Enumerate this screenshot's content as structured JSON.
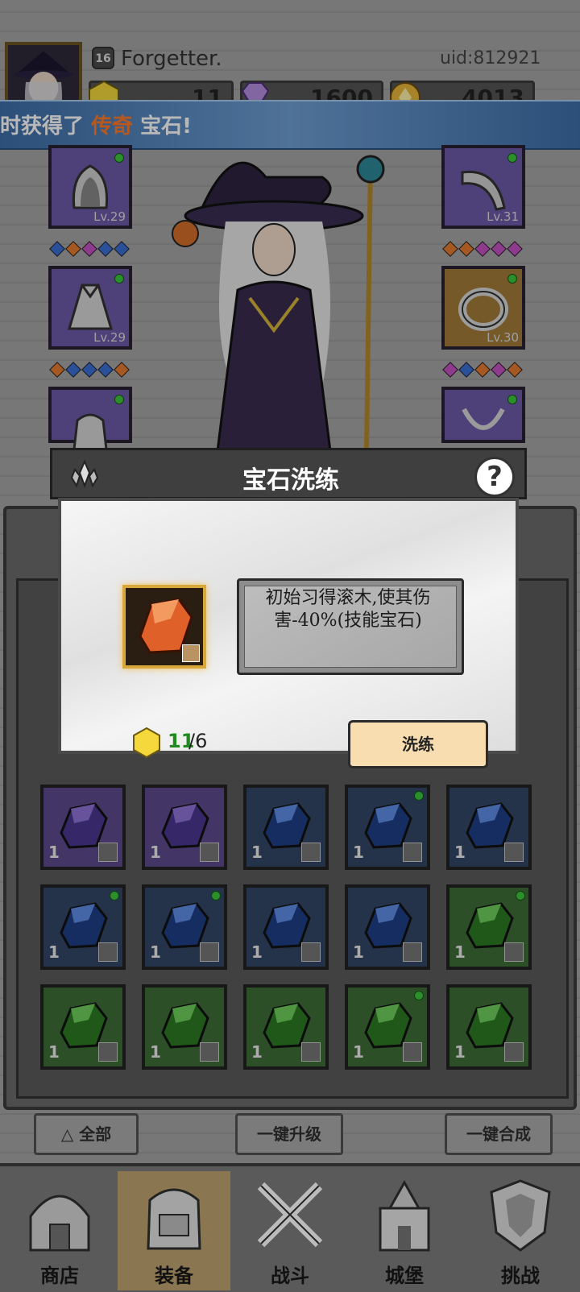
{
  "player": {
    "name": "Forgetter.",
    "level": "16",
    "uid": "uid:812921"
  },
  "currencies": [
    {
      "icon": "hex-gem-icon",
      "value": "11"
    },
    {
      "icon": "diamond-icon",
      "value": "1600"
    },
    {
      "icon": "coin-icon",
      "value": "4013"
    }
  ],
  "banner": {
    "prefix": "时获得了",
    "highlight": "传奇",
    "suffix": "宝石!"
  },
  "equipment": {
    "left": [
      {
        "item": "hood",
        "level": "Lv.29"
      },
      {
        "item": "cloak",
        "level": "Lv.29"
      },
      {
        "item": "bag",
        "level": ""
      }
    ],
    "right": [
      {
        "item": "horn",
        "level": "Lv.31"
      },
      {
        "item": "ring",
        "level": "Lv.30"
      },
      {
        "item": "necklace",
        "level": ""
      }
    ]
  },
  "inventory": {
    "rows": [
      [
        {
          "color": "purple",
          "count": "1",
          "dot": false
        },
        {
          "color": "purple",
          "count": "1",
          "dot": false
        },
        {
          "color": "blue",
          "count": "1",
          "dot": false
        },
        {
          "color": "blue",
          "count": "1",
          "dot": true
        },
        {
          "color": "blue",
          "count": "1",
          "dot": false
        }
      ],
      [
        {
          "color": "blue",
          "count": "1",
          "dot": true
        },
        {
          "color": "blue",
          "count": "1",
          "dot": true
        },
        {
          "color": "blue",
          "count": "1",
          "dot": false
        },
        {
          "color": "blue",
          "count": "1",
          "dot": false
        },
        {
          "color": "green",
          "count": "1",
          "dot": true
        }
      ],
      [
        {
          "color": "green",
          "count": "1",
          "dot": false
        },
        {
          "color": "green",
          "count": "1",
          "dot": false
        },
        {
          "color": "green",
          "count": "1",
          "dot": false
        },
        {
          "color": "green",
          "count": "1",
          "dot": true
        },
        {
          "color": "green",
          "count": "1",
          "dot": false
        }
      ]
    ]
  },
  "buttons": {
    "filter_all": "全部",
    "upgrade_all": "一键升级",
    "merge_all": "一键合成"
  },
  "nav": [
    {
      "label": "商店",
      "icon": "shop-icon"
    },
    {
      "label": "装备",
      "icon": "backpack-icon",
      "active": true
    },
    {
      "label": "战斗",
      "icon": "crossed-swords-icon"
    },
    {
      "label": "城堡",
      "icon": "castle-icon"
    },
    {
      "label": "挑战",
      "icon": "shield-icon"
    }
  ],
  "modal": {
    "title": "宝石洗练",
    "help": "?",
    "description": "初始习得滚木,使其伤害-40%(技能宝石)",
    "cost_have": "11",
    "cost_need": "/6",
    "refine_label": "洗练"
  },
  "colors": {
    "banner_highlight": "#ff7a2a",
    "have_count": "#1f8a1f",
    "refine_button": "#f8ddb0"
  }
}
